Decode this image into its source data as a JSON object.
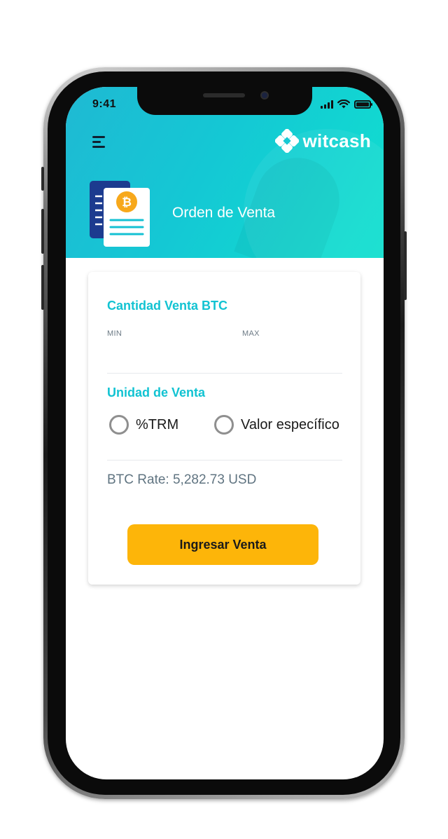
{
  "status_bar": {
    "time": "9:41"
  },
  "header": {
    "brand": "witcash",
    "title": "Orden de Venta"
  },
  "form": {
    "quantity_title": "Cantidad Venta BTC",
    "min_label": "MIN",
    "max_label": "MAX",
    "unit_title": "Unidad de Venta",
    "unit_options": [
      "%TRM",
      "Valor específico"
    ],
    "rate_text": "BTC Rate: 5,282.73 USD",
    "submit_label": "Ingresar Venta"
  },
  "colors": {
    "header_gradient_start": "#1fb9d3",
    "header_gradient_end": "#10e0cf",
    "accent_text": "#12c3d2",
    "button": "#fdb509",
    "bitcoin": "#f7a81b",
    "doc_navy": "#1c3b8f"
  },
  "icons": {
    "menu": "hamburger-icon",
    "logo": "witcash-logo-icon",
    "document": "bitcoin-document-icon",
    "signal": "signal-icon",
    "wifi": "wifi-icon",
    "battery": "battery-icon"
  }
}
